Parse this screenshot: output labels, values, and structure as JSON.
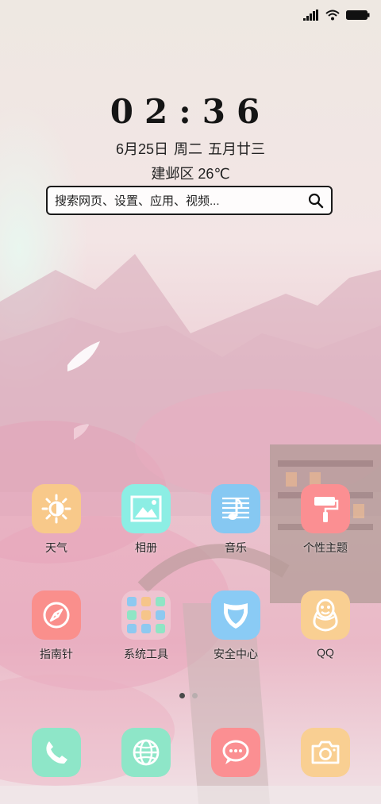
{
  "status_bar": {
    "signal_icon": "signal-bars-icon",
    "wifi_icon": "wifi-icon",
    "battery_icon": "battery-icon"
  },
  "clock": {
    "time": "02:36"
  },
  "date": {
    "date": "6月25日",
    "weekday": "周二",
    "lunar": "五月廿三"
  },
  "weather": {
    "location": "建邺区",
    "temperature": "26℃"
  },
  "search": {
    "placeholder": "搜索网页、设置、应用、视频...",
    "icon": "search-icon"
  },
  "apps": [
    {
      "label": "天气",
      "icon": "sun-icon",
      "color": "#f8c98a"
    },
    {
      "label": "相册",
      "icon": "picture-icon",
      "color": "#8ceee4"
    },
    {
      "label": "音乐",
      "icon": "music-note-icon",
      "color": "#86c8f2"
    },
    {
      "label": "个性主题",
      "icon": "paint-roller-icon",
      "color": "#fb8f92"
    },
    {
      "label": "指南针",
      "icon": "compass-icon",
      "color": "#fa8f8c"
    },
    {
      "label": "系统工具",
      "icon": "folder-icon",
      "color": "transparent"
    },
    {
      "label": "安全中心",
      "icon": "shield-icon",
      "color": "#8acbf5"
    },
    {
      "label": "QQ",
      "icon": "penguin-icon",
      "color": "#f9cf92"
    }
  ],
  "page_indicator": {
    "pages": 2,
    "current": 1
  },
  "dock": [
    {
      "icon": "phone-icon",
      "color": "#8ee6c8"
    },
    {
      "icon": "browser-globe-icon",
      "color": "#8ee6c8"
    },
    {
      "icon": "message-icon",
      "color": "#fb8f92"
    },
    {
      "icon": "camera-icon",
      "color": "#f9cf92"
    }
  ]
}
